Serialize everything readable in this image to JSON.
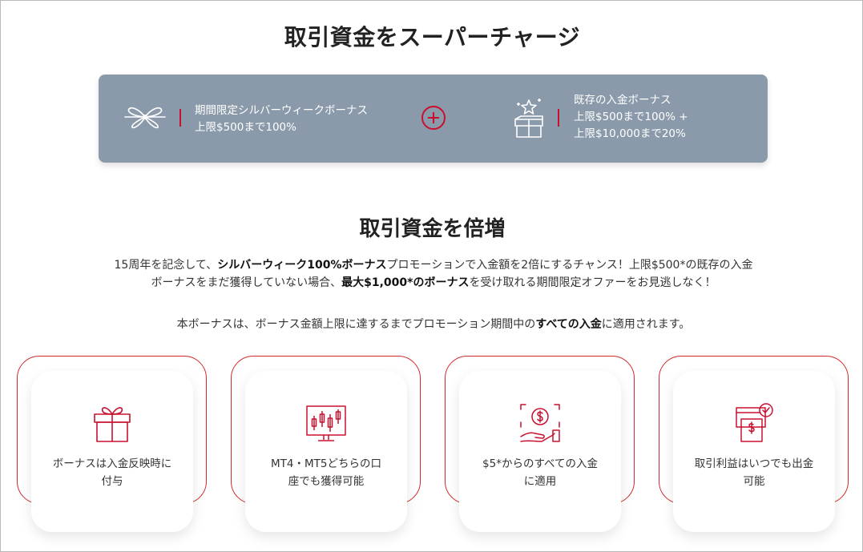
{
  "title_supercharge": "取引資金をスーパーチャージ",
  "banner": {
    "left_line1": "期間限定シルバーウィークボーナス",
    "left_line2": "上限$500まで100%",
    "right_line1": "既存の入金ボーナス",
    "right_line2": "上限$500まで100% +",
    "right_line3": "上限$10,000まで20%",
    "bg_color": "#8a9aaa",
    "accent_color": "#c8102e"
  },
  "title_double": "取引資金を倍増",
  "paragraph1": {
    "s1": "15周年を記念して、",
    "b1": "シルバーウィーク100%ボーナス",
    "s2": "プロモーションで入金額を2倍にするチャンス！上限$500*の既存の入金ボーナスをまだ獲得していない場合、",
    "b2": "最大$1,000*のボーナス",
    "s3": "を受け取れる期間限定オファーをお見逃しなく！"
  },
  "paragraph2": {
    "s1": "本ボーナスは、ボーナス金額上限に達するまでプロモーション期間中の",
    "b1": "すべての入金",
    "s2": "に適用されます。"
  },
  "features": [
    {
      "icon": "gift-icon",
      "line1": "ボーナスは入金反映時に",
      "line2": "付与"
    },
    {
      "icon": "candlestick-chart-icon",
      "line1": "MT4・MT5どちらの口",
      "line2": "座でも獲得可能"
    },
    {
      "icon": "dollar-hand-icon",
      "line1": "$5*からのすべての入金",
      "line2": "に適用"
    },
    {
      "icon": "withdraw-check-icon",
      "line1": "取引利益はいつでも出金",
      "line2": "可能"
    }
  ]
}
